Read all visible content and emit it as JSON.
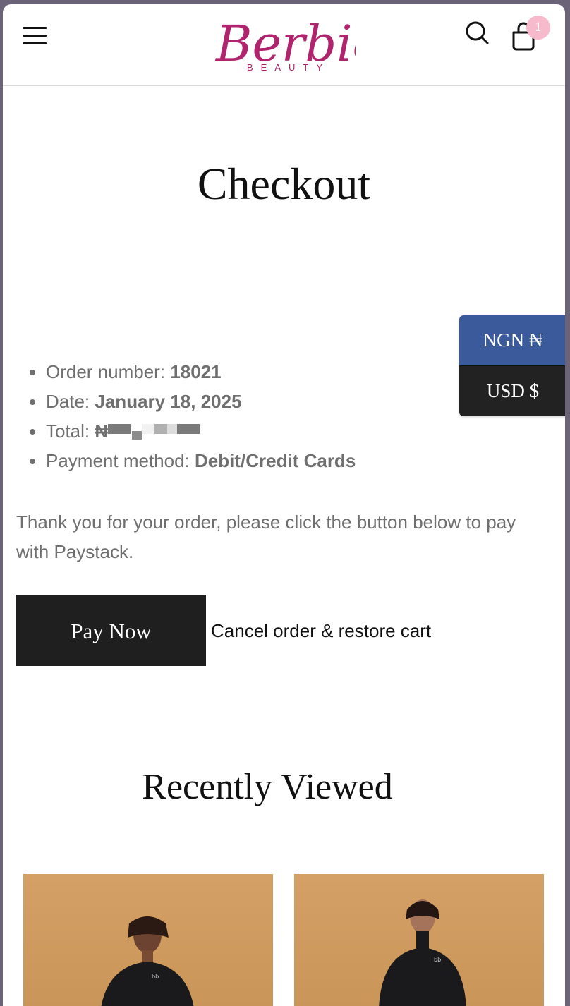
{
  "header": {
    "menu_icon": "hamburger-icon",
    "logo_text": "Berbie",
    "logo_subtext": "BEAUTY",
    "search_icon": "search-icon",
    "cart_icon": "shopping-bag-icon",
    "cart_count": "1"
  },
  "page": {
    "title": "Checkout"
  },
  "currency_switcher": {
    "options": [
      {
        "label": "NGN ₦",
        "active": true
      },
      {
        "label": "USD $",
        "active": false
      }
    ],
    "active_color": "#3a5a9c",
    "inactive_color": "#222222"
  },
  "order": {
    "number_label": "Order number:",
    "number_value": "18021",
    "date_label": "Date:",
    "date_value": "January 18, 2025",
    "total_label": "Total:",
    "total_value": "₦",
    "payment_label": "Payment method:",
    "payment_value": "Debit/Credit Cards"
  },
  "message": "Thank you for your order, please click the button below to pay with Paystack.",
  "actions": {
    "pay_now": "Pay Now",
    "cancel": "Cancel order & restore cart"
  },
  "recently_viewed": {
    "title": "Recently Viewed",
    "products": [
      {
        "image": "model-in-black-zip-top"
      },
      {
        "image": "model-in-black-zip-top"
      }
    ]
  },
  "colors": {
    "brand": "#b0246d",
    "button": "#1f1f1f",
    "text_muted": "#6f6f6f",
    "badge": "#f7b9cc"
  }
}
